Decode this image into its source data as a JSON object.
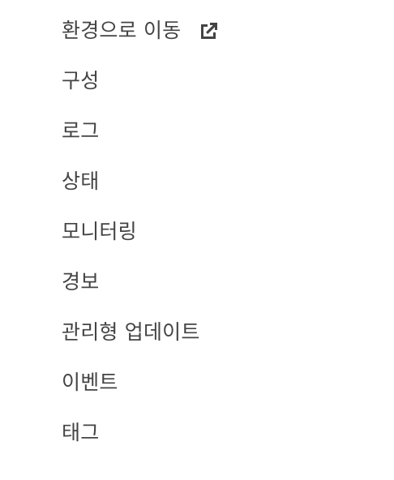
{
  "nav": {
    "items": [
      {
        "label": "환경으로 이동",
        "icon": "external-link-icon"
      },
      {
        "label": "구성"
      },
      {
        "label": "로그"
      },
      {
        "label": "상태"
      },
      {
        "label": "모니터링"
      },
      {
        "label": "경보"
      },
      {
        "label": "관리형 업데이트"
      },
      {
        "label": "이벤트"
      },
      {
        "label": "태그"
      }
    ]
  },
  "colors": {
    "text": "#444444",
    "icon": "#444444",
    "background": "#ffffff"
  }
}
